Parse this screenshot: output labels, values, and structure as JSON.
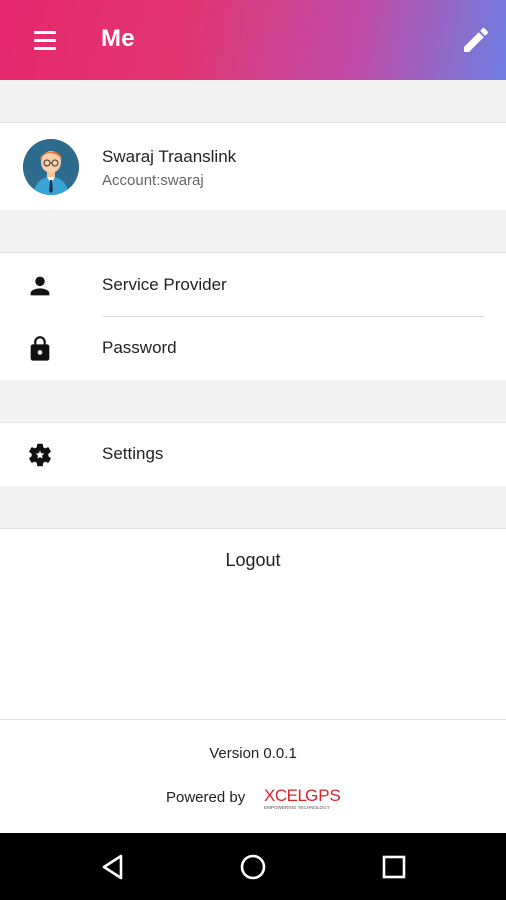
{
  "appbar": {
    "title": "Me",
    "menu_icon": "hamburger-menu-icon",
    "edit_icon": "pencil-edit-icon",
    "gradient": [
      "#e6286e",
      "#c04aa6",
      "#6f7fe2"
    ]
  },
  "profile": {
    "name": "Swaraj Traanslink",
    "account": "Account:swaraj",
    "avatar_icon": "user-avatar-icon"
  },
  "menu": {
    "service_provider": {
      "label": "Service Provider",
      "icon": "person-icon"
    },
    "password": {
      "label": "Password",
      "icon": "lock-icon"
    },
    "settings": {
      "label": "Settings",
      "icon": "settings-gear-icon"
    }
  },
  "logout": {
    "label": "Logout"
  },
  "footer": {
    "version": "Version 0.0.1",
    "powered_by": "Powered by",
    "logo_text_main": "XCEL",
    "logo_text_accent": "GPS",
    "logo_tagline": "EMPOWERING TECHNOLOGY"
  },
  "navbar": {
    "back_icon": "back-triangle-icon",
    "home_icon": "home-circle-icon",
    "recents_icon": "recents-square-icon"
  }
}
